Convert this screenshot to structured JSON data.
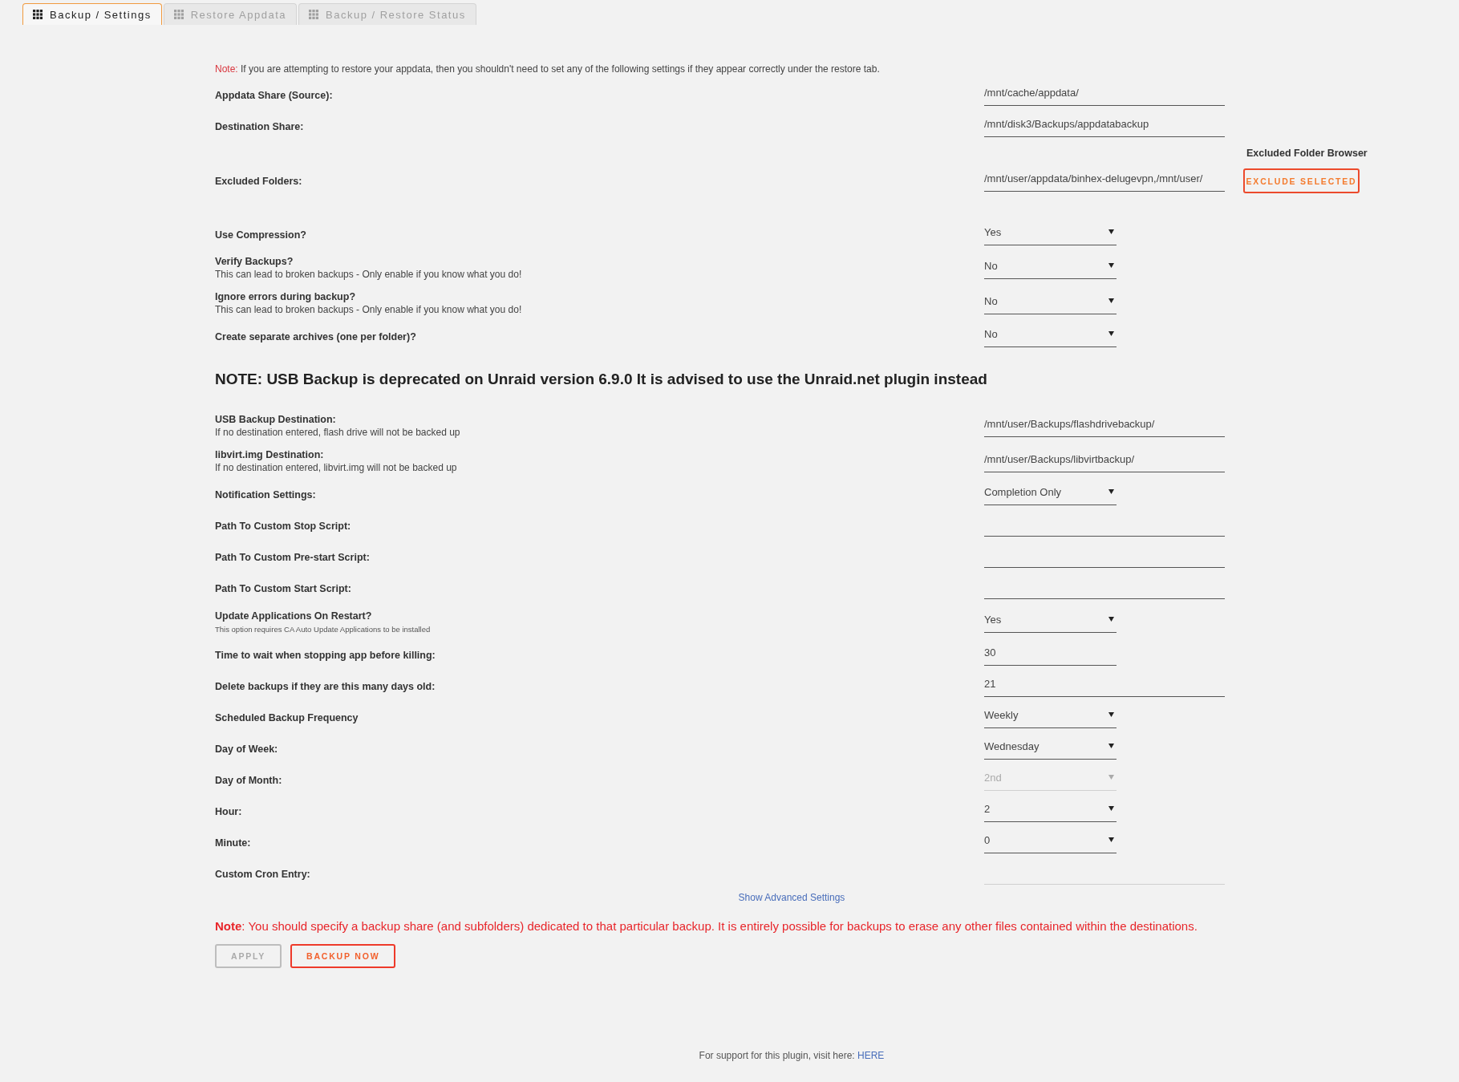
{
  "tabs": [
    {
      "label": "Backup / Settings",
      "selected": true
    },
    {
      "label": "Restore Appdata",
      "selected": false
    },
    {
      "label": "Backup / Restore Status",
      "selected": false
    }
  ],
  "intro_note": {
    "prefix": "Note:",
    "text": "If you are attempting to restore your appdata, then you shouldn't need to set any of the following settings if they appear correctly under the restore tab."
  },
  "settings": [
    {
      "kind": "input",
      "label": "Appdata Share (Source):",
      "value": "/mnt/cache/appdata/",
      "disabled": false
    },
    {
      "kind": "input",
      "label": "Destination Share:",
      "value": "/mnt/disk3/Backups/appdatabackup",
      "disabled": false
    },
    {
      "kind": "folder_input",
      "label": "Excluded Folders:",
      "value": "/mnt/user/appdata/binhex-delugevpn,/mnt/user/",
      "disabled": false,
      "browser_label": "Excluded Folder Browser",
      "button": "EXCLUDE SELECTED"
    },
    {
      "kind": "select",
      "label": "Use Compression?",
      "value": "Yes",
      "disabled": false
    },
    {
      "kind": "select",
      "label": "Verify Backups?",
      "hint": "This can lead to broken backups - Only enable if you know what you do!",
      "value": "No",
      "disabled": false
    },
    {
      "kind": "select",
      "label": "Ignore errors during backup?",
      "hint": "This can lead to broken backups - Only enable if you know what you do!",
      "value": "No",
      "disabled": false
    },
    {
      "kind": "select",
      "label": "Create separate archives (one per folder)?",
      "value": "No",
      "disabled": false
    },
    {
      "kind": "heading",
      "text": "NOTE: USB Backup is deprecated on Unraid version 6.9.0 It is advised to use the Unraid.net plugin instead"
    },
    {
      "kind": "input",
      "label": "USB Backup Destination:",
      "hint": "If no destination entered, flash drive will not be backed up",
      "value": "/mnt/user/Backups/flashdrivebackup/",
      "disabled": false
    },
    {
      "kind": "input",
      "label": "libvirt.img Destination:",
      "hint": "If no destination entered, libvirt.img will not be backed up",
      "value": "/mnt/user/Backups/libvirtbackup/",
      "disabled": false
    },
    {
      "kind": "select",
      "label": "Notification Settings:",
      "value": "Completion Only",
      "disabled": false
    },
    {
      "kind": "input",
      "label": "Path To Custom Stop Script:",
      "disabled": false
    },
    {
      "kind": "input",
      "label": "Path To Custom Pre-start Script:",
      "disabled": false
    },
    {
      "kind": "input",
      "label": "Path To Custom Start Script:",
      "disabled": false
    },
    {
      "kind": "select",
      "label": "Update Applications On Restart?",
      "fine_print": "This option requires CA Auto Update Applications to be installed",
      "value": "Yes",
      "disabled": false
    },
    {
      "kind": "short_input",
      "label": "Time to wait when stopping app before killing:",
      "value": "30",
      "disabled": false
    },
    {
      "kind": "input",
      "label": "Delete backups if they are this many days old:",
      "value": "21",
      "disabled": false
    },
    {
      "kind": "select",
      "label": "Scheduled Backup Frequency",
      "value": "Weekly",
      "disabled": false
    },
    {
      "kind": "select",
      "label": "Day of Week:",
      "value": "Wednesday",
      "disabled": false
    },
    {
      "kind": "select",
      "label": "Day of Month:",
      "value": "2nd",
      "disabled": true
    },
    {
      "kind": "select",
      "label": "Hour:",
      "value": "2",
      "disabled": false
    },
    {
      "kind": "select",
      "label": "Minute:",
      "value": "0",
      "disabled": false
    },
    {
      "kind": "input",
      "label": "Custom Cron Entry:",
      "disabled": true
    }
  ],
  "advanced_link": "Show Advanced Settings",
  "warning": "**Note**: You should specify a backup share (and subfolders) dedicated to that particular backup. It is entirely possible for backups to erase any other files contained within the destinations.",
  "buttons": [
    {
      "label": "APPLY",
      "disabled": true
    },
    {
      "label": "BACKUP NOW",
      "disabled": false
    }
  ],
  "footer": {
    "text": "For support for this plugin, visit here:",
    "link": "HERE"
  }
}
